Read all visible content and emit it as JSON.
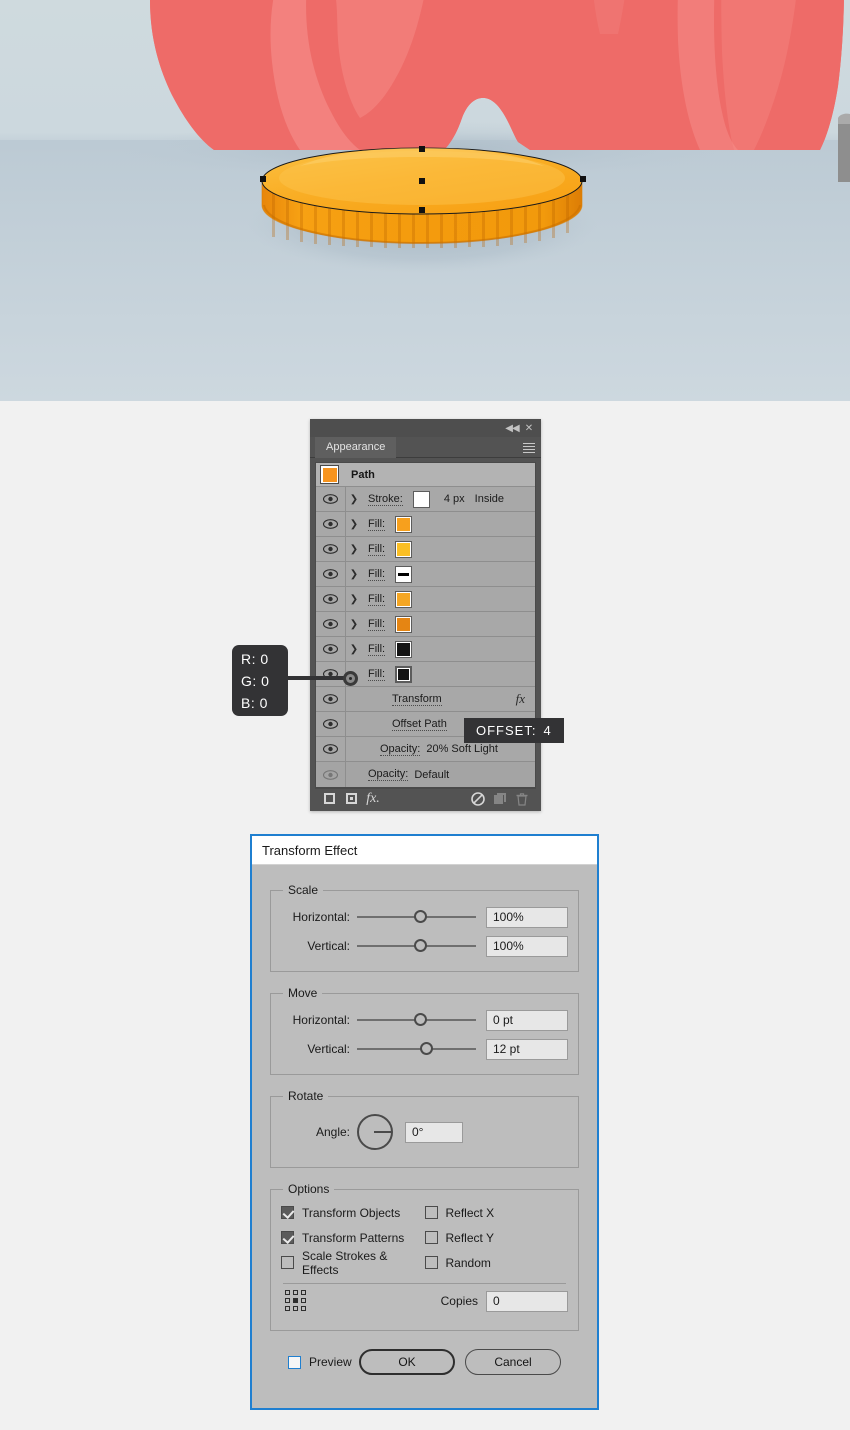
{
  "illustration": {
    "name": "bottle-cap-artwork",
    "description": "Orange ribbed bottle cap on light blue surface with red bottle above",
    "colors": {
      "background_top": "#cfdae0",
      "background_bottom": "#c3d0d8",
      "bottle_red": "#ef6b68",
      "bottle_red_light": "#f48c89",
      "cap_top": "#f9b233",
      "cap_top_light": "#fbc34b",
      "cap_side": "#f39200",
      "cap_side_dark": "#e07c00",
      "shadow": "#b3c2cb"
    }
  },
  "appearance_panel": {
    "title_tab": "Appearance",
    "collapse_icon": "double-chevron-left-icon",
    "close_icon": "close-icon",
    "menu_icon": "panel-menu-icon",
    "header_row": {
      "thumbnail": "path-thumbnail",
      "label": "Path"
    },
    "rows": [
      {
        "type": "stroke",
        "eye": "visible",
        "arrow": true,
        "label": "Stroke:",
        "swatch": "#ffffff",
        "swatch_kind": "solid",
        "meta_weight": "4 px",
        "meta_align": "Inside"
      },
      {
        "type": "fill",
        "eye": "visible",
        "arrow": true,
        "label": "Fill:",
        "swatch": "#f7a01d",
        "swatch_kind": "solid"
      },
      {
        "type": "fill",
        "eye": "visible",
        "arrow": true,
        "label": "Fill:",
        "swatch": "#fbbf24",
        "swatch_kind": "solid"
      },
      {
        "type": "fill",
        "eye": "visible",
        "arrow": true,
        "label": "Fill:",
        "swatch": "#ffffff",
        "swatch_kind": "none"
      },
      {
        "type": "fill",
        "eye": "visible",
        "arrow": true,
        "label": "Fill:",
        "swatch": "#f5a623",
        "swatch_kind": "solid"
      },
      {
        "type": "fill",
        "eye": "visible",
        "arrow": true,
        "label": "Fill:",
        "swatch": "#e58513",
        "swatch_kind": "solid"
      },
      {
        "type": "fill",
        "eye": "visible",
        "arrow": true,
        "label": "Fill:",
        "swatch": "#141414",
        "swatch_kind": "solid"
      },
      {
        "type": "fill",
        "eye": "visible",
        "arrow": false,
        "label": "Fill:",
        "swatch": "#141414",
        "swatch_kind": "solid",
        "selected": true
      }
    ],
    "effect_rows": [
      {
        "label": "Transform",
        "eye": "visible",
        "fx": "fx"
      },
      {
        "label": "Offset Path",
        "eye": "visible",
        "fx": ""
      }
    ],
    "opacity_rows": [
      {
        "label": "Opacity:",
        "value": "20% Soft Light",
        "eye": "visible"
      },
      {
        "label": "Opacity:",
        "value": "Default",
        "eye": "hidden"
      }
    ],
    "footer_icons": [
      {
        "name": "new-fill-icon",
        "enabled": true
      },
      {
        "name": "new-stroke-icon",
        "enabled": true
      },
      {
        "name": "add-effect-icon",
        "label": "fx.",
        "enabled": true
      },
      {
        "name": "clear-appearance-icon",
        "enabled": true
      },
      {
        "name": "duplicate-item-icon",
        "enabled": false
      },
      {
        "name": "delete-item-icon",
        "enabled": false
      }
    ]
  },
  "callouts": {
    "rgb": {
      "r": "R: 0",
      "g": "G: 0",
      "b": "B: 0"
    },
    "offset_tooltip": {
      "label": "OFFSET:",
      "value": "4"
    }
  },
  "transform_dialog": {
    "title": "Transform Effect",
    "accent_color": "#1f7fd0",
    "groups": {
      "scale": {
        "legend": "Scale",
        "fields": [
          {
            "label": "Horizontal:",
            "value": "100%",
            "knob_pct": 48
          },
          {
            "label": "Vertical:",
            "value": "100%",
            "knob_pct": 48
          }
        ]
      },
      "move": {
        "legend": "Move",
        "fields": [
          {
            "label": "Horizontal:",
            "value": "0 pt",
            "knob_pct": 48
          },
          {
            "label": "Vertical:",
            "value": "12 pt",
            "knob_pct": 53
          }
        ]
      },
      "rotate": {
        "legend": "Rotate",
        "label": "Angle:",
        "value": "0°",
        "dial_icon": "angle-dial-icon"
      },
      "options": {
        "legend": "Options",
        "left_column": [
          {
            "label": "Transform Objects",
            "checked": true
          },
          {
            "label": "Transform Patterns",
            "checked": true
          },
          {
            "label": "Scale Strokes & Effects",
            "checked": false
          }
        ],
        "right_column": [
          {
            "label": "Reflect X",
            "checked": false
          },
          {
            "label": "Reflect Y",
            "checked": false
          },
          {
            "label": "Random",
            "checked": false
          }
        ],
        "reference_point_icon": "reference-point-grid-icon",
        "reference_point_selected": "center",
        "copies_label": "Copies",
        "copies_value": "0"
      }
    },
    "footer": {
      "preview_label": "Preview",
      "preview_checked": false,
      "ok_label": "OK",
      "cancel_label": "Cancel"
    }
  }
}
